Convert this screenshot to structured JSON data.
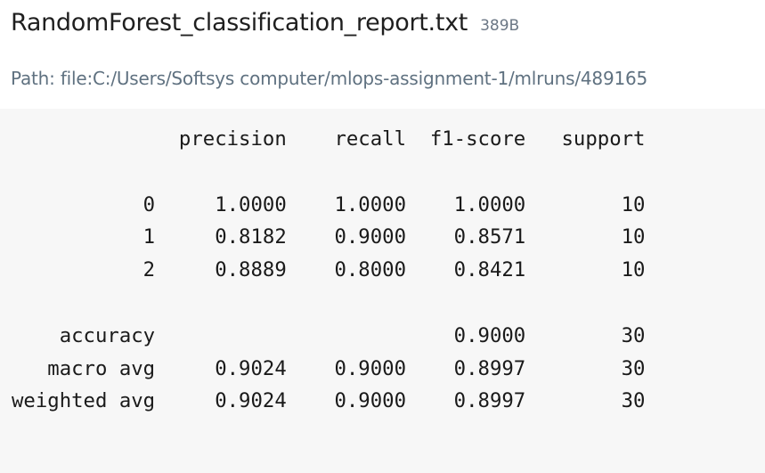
{
  "file": {
    "name": "RandomForest_classification_report.txt",
    "size": "389B",
    "path": "Path: file:C:/Users/Softsys computer/mlops-assignment-1/mlruns/489165"
  },
  "report": {
    "lines": [
      "              precision    recall  f1-score   support",
      "",
      "           0     1.0000    1.0000    1.0000        10",
      "           1     0.8182    0.9000    0.8571        10",
      "           2     0.8889    0.8000    0.8421        10",
      "",
      "    accuracy                         0.9000        30",
      "   macro avg     0.9024    0.9000    0.8997        30",
      "weighted avg     0.9024    0.9000    0.8997        30"
    ]
  }
}
